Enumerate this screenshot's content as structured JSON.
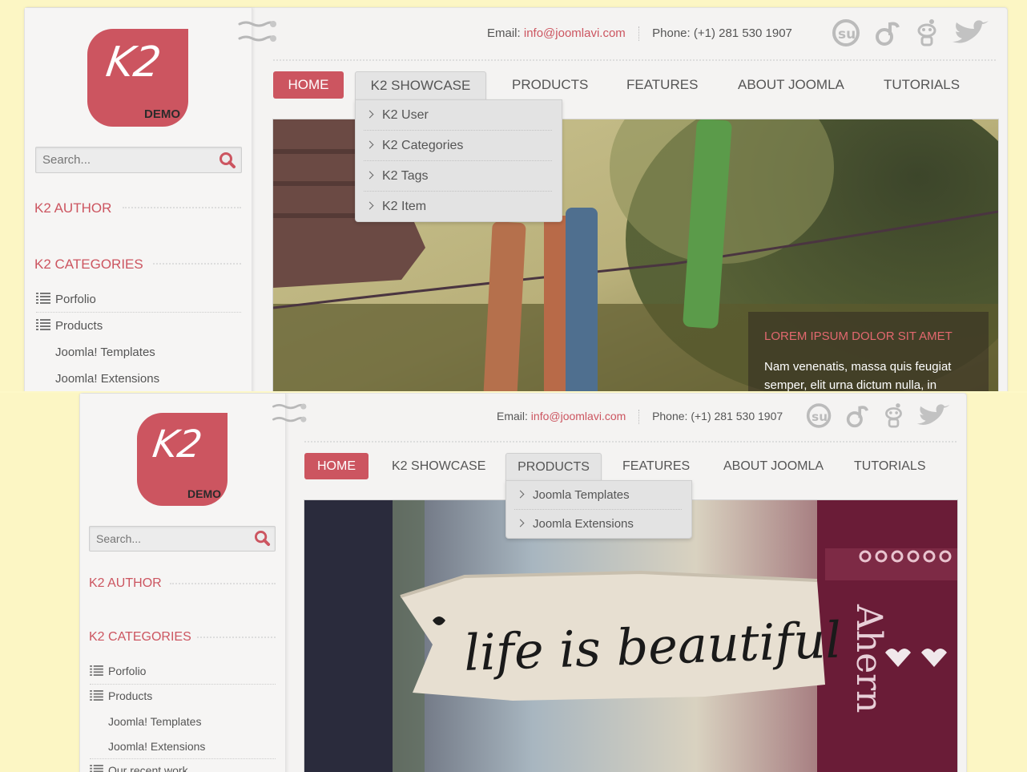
{
  "site": {
    "logo_text": "K2",
    "logo_demo": "DEMO",
    "search_placeholder": "Search...",
    "email_label": "Email:",
    "email_value": "info@joomlavi.com",
    "phone_label": "Phone:",
    "phone_value": "(+1) 281 530 1907",
    "social_icons": [
      "stumbleupon-icon",
      "digg-icon",
      "reddit-icon",
      "twitter-icon"
    ],
    "accent_color": "#cc5560"
  },
  "nav": {
    "home": "HOME",
    "k2_showcase": "K2 SHOWCASE",
    "products": "PRODUCTS",
    "features": "FEATURES",
    "about_joomla": "ABOUT JOOMLA",
    "tutorials": "TUTORIALS"
  },
  "sidebar": {
    "author_title": "K2 AUTHOR",
    "categories_title": "K2 CATEGORIES",
    "categories": [
      "Porfolio",
      "Products",
      "Joomla! Templates",
      "Joomla! Extensions",
      "Our recent work"
    ]
  },
  "top_screenshot": {
    "open_menu": "K2 SHOWCASE",
    "dropdown": [
      "K2 User",
      "K2 Categories",
      "K2 Tags",
      "K2 Item"
    ],
    "caption_title": "LOREM IPSUM DOLOR SIT AMET",
    "caption_text": "Nam venenatis, massa quis feugiat semper, elit urna dictum nulla, in"
  },
  "bottom_screenshot": {
    "open_menu": "PRODUCTS",
    "dropdown": [
      "Joomla Templates",
      "Joomla Extensions"
    ],
    "photo_text": "life is beautiful",
    "photo_side_text": "Ahern"
  }
}
